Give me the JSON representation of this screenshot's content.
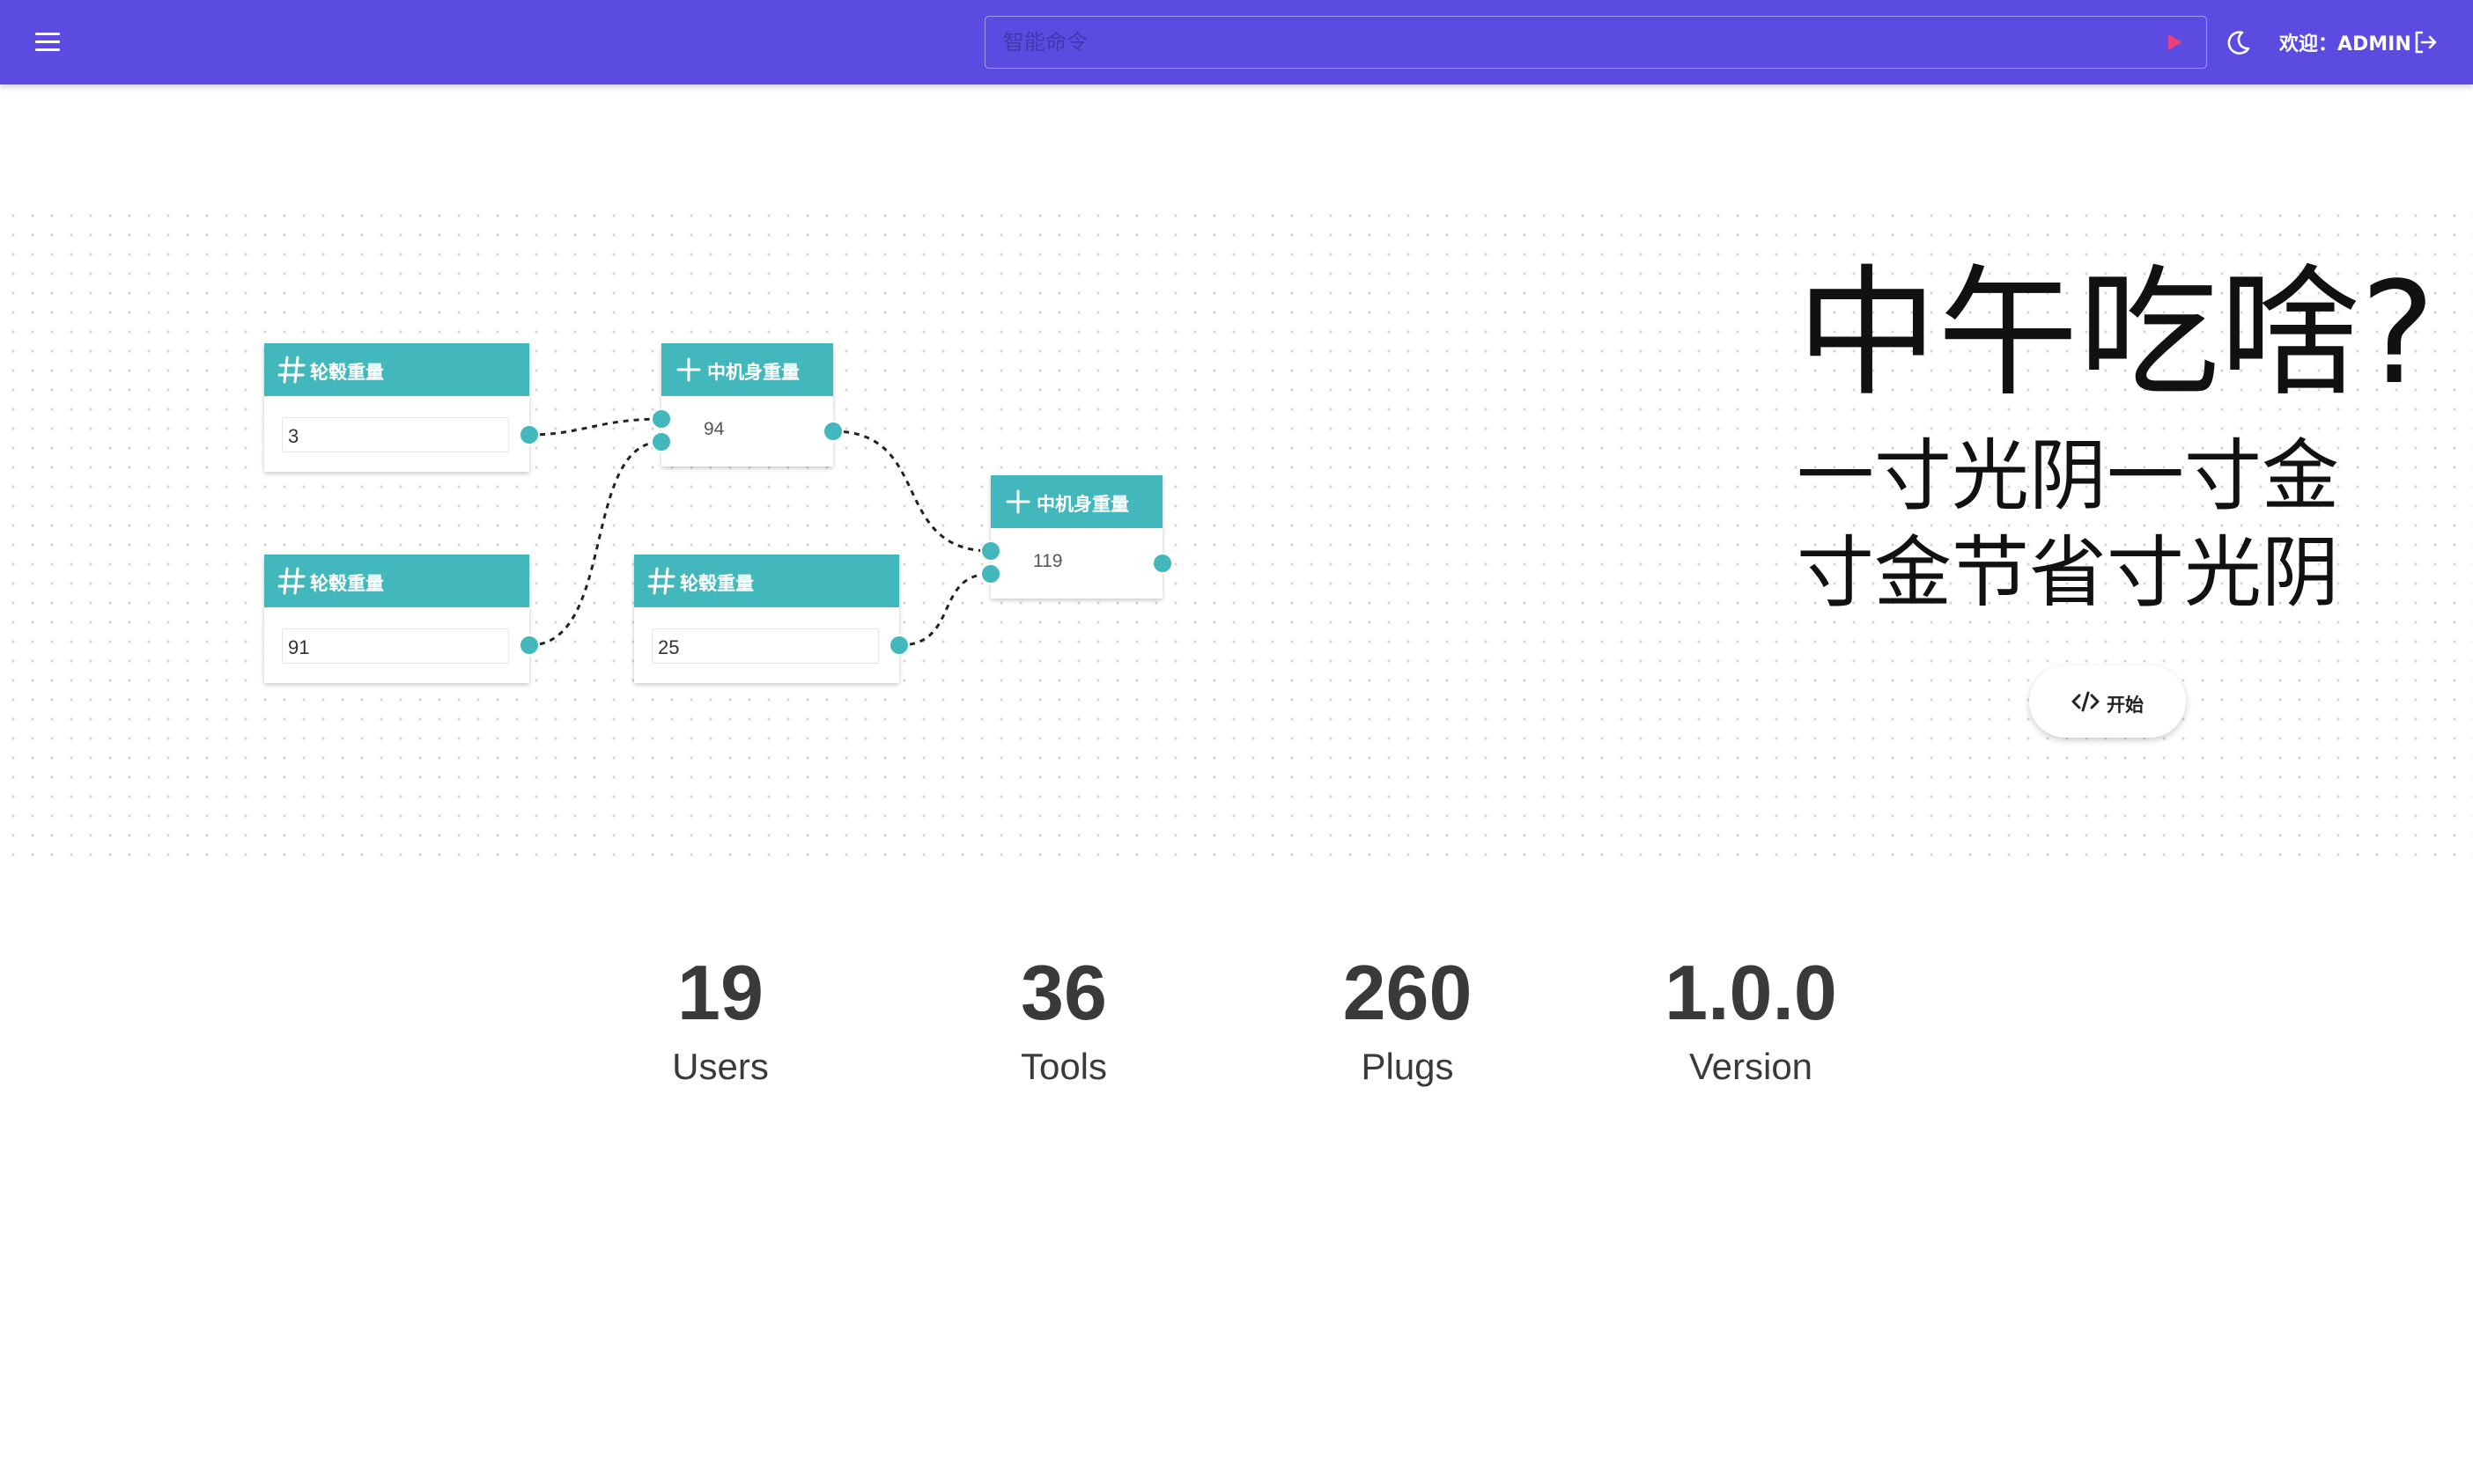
{
  "header": {
    "command_placeholder": "智能命令",
    "welcome": "欢迎：ADMIN",
    "accent_color": "#5c4be0"
  },
  "flow": {
    "node_color": "#42b8bc",
    "nodes": [
      {
        "id": "n1",
        "kind": "number",
        "icon": "hash-icon",
        "title": "轮毂重量",
        "value": "3"
      },
      {
        "id": "n2",
        "kind": "number",
        "icon": "hash-icon",
        "title": "轮毂重量",
        "value": "91"
      },
      {
        "id": "n3",
        "kind": "add",
        "icon": "plus-icon",
        "title": "中机身重量",
        "value": "94"
      },
      {
        "id": "n4",
        "kind": "number",
        "icon": "hash-icon",
        "title": "轮毂重量",
        "value": "25"
      },
      {
        "id": "n5",
        "kind": "add",
        "icon": "plus-icon",
        "title": "中机身重量",
        "value": "119"
      }
    ]
  },
  "hero": {
    "title": "中午吃啥?",
    "subtitle_line1": "一寸光阴一寸金",
    "subtitle_line2": "寸金节省寸光阴",
    "start_label": "开始"
  },
  "stats": [
    {
      "value": "19",
      "label": "Users"
    },
    {
      "value": "36",
      "label": "Tools"
    },
    {
      "value": "260",
      "label": "Plugs"
    },
    {
      "value": "1.0.0",
      "label": "Version"
    }
  ]
}
